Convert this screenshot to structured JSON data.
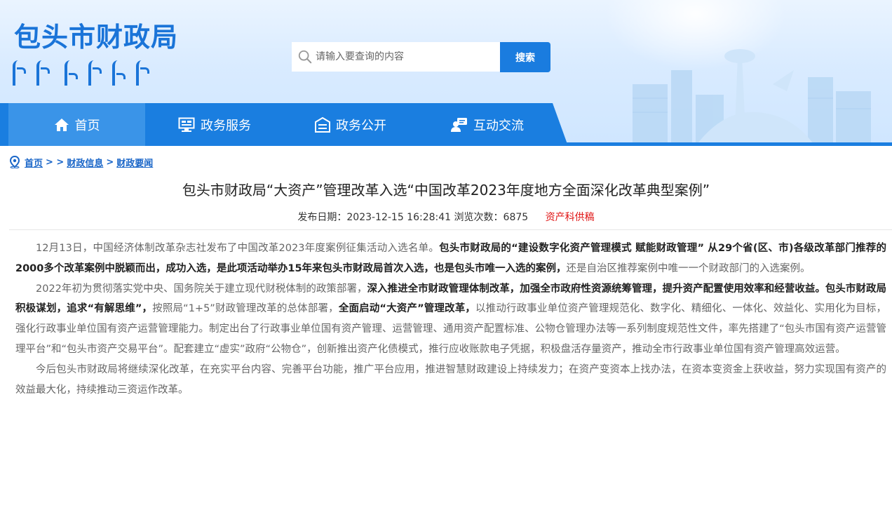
{
  "header": {
    "site_title": "包头市财政局",
    "search_placeholder": "请输入要查询的内容",
    "search_button": "搜索"
  },
  "nav": {
    "items": [
      {
        "label": "首页",
        "icon": "home-icon"
      },
      {
        "label": "政务服务",
        "icon": "monitor-icon"
      },
      {
        "label": "政务公开",
        "icon": "building-icon"
      },
      {
        "label": "互动交流",
        "icon": "chat-user-icon"
      }
    ]
  },
  "breadcrumb": {
    "icon": "location-pin-icon",
    "home": "首页",
    "sep1": "> >",
    "level1": "财政信息",
    "sep2": ">",
    "level2": "财政要闻"
  },
  "article": {
    "title": "包头市财政局“大资产”管理改革入选“中国改革2023年度地方全面深化改革典型案例”",
    "meta_date_label": "发布日期：",
    "meta_date": "2023-12-15 16:28:41",
    "meta_views_label": "浏览次数：",
    "meta_views": "6875",
    "meta_source": "资产科供稿",
    "p1_a": "12月13日，中国经济体制改革杂志社发布了中国改革2023年度案例征集活动入选名单。",
    "p1_b": "包头市财政局的“建设数字化资产管理模式 赋能财政管理” 从29个省(区、市)各级改革部门推荐的2000多个改革案例中脱颖而出，成功入选，是此项活动举办15年来包头市财政局首次入选，也是包头市唯一入选的案例，",
    "p1_c": "还是自治区推荐案例中唯一一个财政部门的入选案例。",
    "p2_a": "2022年初为贯彻落实党中央、国务院关于建立现代财税体制的政策部署，",
    "p2_b": "深入推进全市财政管理体制改革，加强全市政府性资源统筹管理，提升资产配置使用效率和经营收益。包头市财政局积极谋划，追求“有解思维”，",
    "p2_c": "按照局“1+5”财政管理改革的总体部署，",
    "p2_d": "全面启动“大资产”管理改革，",
    "p2_e": "以推动行政事业单位资产管理规范化、数字化、精细化、一体化、效益化、实用化为目标，强化行政事业单位国有资产运营管理能力。制定出台了行政事业单位国有资产管理、运营管理、通用资产配置标准、公物仓管理办法等一系列制度规范性文件，率先搭建了“包头市国有资产运营管理平台”和“包头市资产交易平台”。配套建立“虚实”政府“公物仓”，创新推出资产化债模式，推行应收账款电子凭据，积极盘活存量资产，推动全市行政事业单位国有资产管理高效运营。",
    "p3": "今后包头市财政局将继续深化改革，在充实平台内容、完善平台功能，推广平台应用，推进智慧财政建设上持续发力；在资产变资本上找办法，在资本变资金上获收益，努力实现国有资产的效益最大化，持续推动三资运作改革。"
  },
  "colors": {
    "brand_blue": "#1a7ee0",
    "title_blue": "#1a74d8",
    "source_red": "#e01515"
  }
}
